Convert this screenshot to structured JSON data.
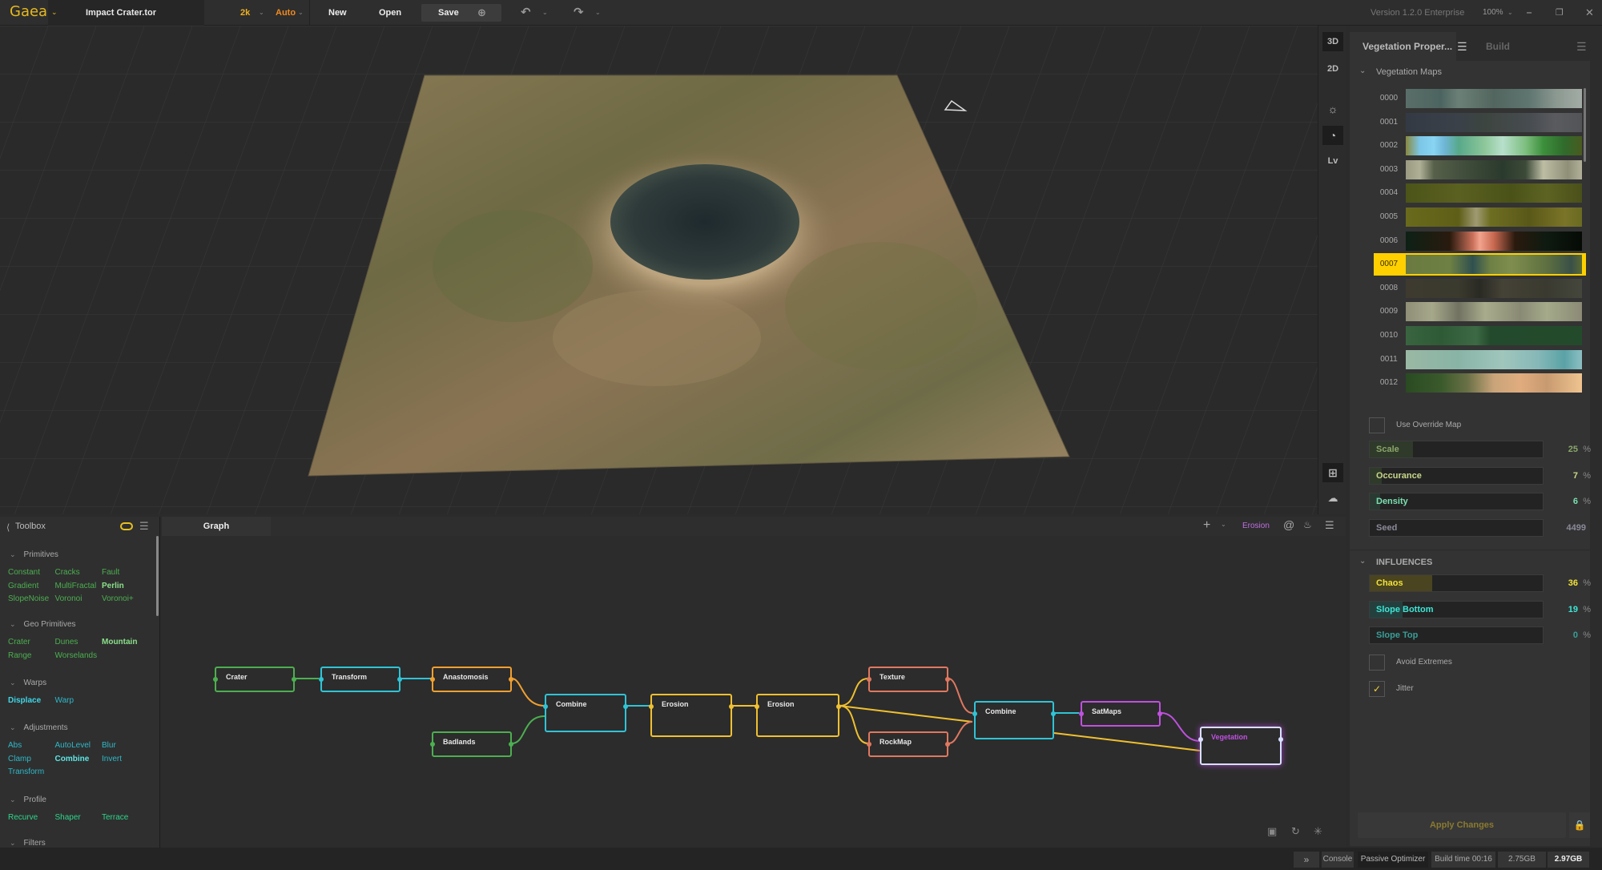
{
  "app": {
    "name": "Gaea",
    "file_name": "Impact Crater.tor",
    "resolution": "2k",
    "build_mode": "Auto",
    "new_label": "New",
    "open_label": "Open",
    "save_label": "Save",
    "version": "Version 1.2.0 Enterprise",
    "zoom": "100%"
  },
  "viewport": {
    "buttons": [
      "3D",
      "2D",
      "Lv"
    ],
    "active_mode": "3D"
  },
  "right_panel": {
    "tabs": [
      "Vegetation Proper...",
      "Build"
    ],
    "section_maps": "Vegetation Maps",
    "maps": [
      {
        "id": "0000",
        "gradient": "linear-gradient(90deg,#5a6e68,#4c6460 20%,#6b8076 30%,#52665f 50%,#5f7570 70%,#8a9890 85%,#a3aca6)"
      },
      {
        "id": "0001",
        "gradient": "linear-gradient(90deg,#343a44,#3a4149 30%,#3d4540 45%,#474c50 70%,#5a5b5f 85%,#525457)"
      },
      {
        "id": "0002",
        "gradient": "linear-gradient(90deg,#8a8a3e,#7cc6e8 8%,#88d4f2 16%,#6fb5d6 22%,#57a98a 30%,#8ec79a 45%,#b8e0cc 55%,#7ebe7f 68%,#3d8f3c 78%,#2f6b2b 90%,#4a5a20)"
      },
      {
        "id": "0003",
        "gradient": "linear-gradient(90deg,#9a9a82,#b0b096 8%,#56604a 16%,#3f4c3a 35%,#2a3a2c 55%,#3c4a38 68%,#bdbda4 78%,#8f8f78 92%,#b2b098)"
      },
      {
        "id": "0004",
        "gradient": "linear-gradient(90deg,#4c5418,#5a6020 30%,#4a5218 60%,#5d6322 80%,#4a5019)"
      },
      {
        "id": "0005",
        "gradient": "linear-gradient(90deg,#6a6a1c,#5e5e18 30%,#a09a72 40%,#6e6e22 48%,#5a5818 70%,#7a7428 90%,#6a6a22)"
      },
      {
        "id": "0006",
        "gradient": "linear-gradient(90deg,#0d2015,#2a1a0e 25%,#c9705a 38%,#f2a38e 42%,#c86850 50%,#2a1a0e 62%,#0e1a10 80%,#050a05)"
      },
      {
        "id": "0007",
        "gradient": "linear-gradient(90deg,#6a7a40,#6e8044 25%,#2f5050 38%,#6e8044 48%,#7f8e4e 60%,#5e7040 80%,#3a5048 94%,#5a6a32)"
      },
      {
        "id": "0008",
        "gradient": "linear-gradient(90deg,#3e3a30,#3a3a2e 30%,#2a2a24 42%,#454236 55%,#3a3a30 80%,#45473c)"
      },
      {
        "id": "0009",
        "gradient": "linear-gradient(90deg,#8f8e78,#a6a88a 15%,#727262 30%,#a8ac8c 45%,#8a8a74 65%,#a4aa8a 80%,#8c8a76)"
      },
      {
        "id": "0010",
        "gradient": "linear-gradient(90deg,#3a6440,#2e5a36 20%,#3d6a44 40%,#234a2c 48%,#244a2c 100%)"
      },
      {
        "id": "0011",
        "gradient": "linear-gradient(90deg,#9ab8a4,#88b4a6 30%,#a0c6bc 55%,#86b8b8 75%,#5aa2a6 90%,#8cc0c4)"
      },
      {
        "id": "0012",
        "gradient": "linear-gradient(90deg,#2a4a22,#3a5a2c 20%,#6a7046 35%,#c9a47a 50%,#e0ac7e 65%,#c89a70 80%,#f0c490)"
      }
    ],
    "selected_map": "0007",
    "use_override_label": "Use Override Map",
    "use_override_checked": false,
    "params": [
      {
        "name": "Scale",
        "value": "25",
        "unit": "%",
        "fraction": 0.25,
        "color": "#8aa66a",
        "fill": "#2f3a2a",
        "dim": true
      },
      {
        "name": "Occurance",
        "value": "7",
        "unit": "%",
        "fraction": 0.07,
        "color": "#c8d88a",
        "fill": "#2f3a2a",
        "dim": false
      },
      {
        "name": "Density",
        "value": "6",
        "unit": "%",
        "fraction": 0.06,
        "color": "#7be0b0",
        "fill": "#2a3a32",
        "dim": false
      },
      {
        "name": "Seed",
        "value": "4499",
        "unit": "",
        "fraction": 0.0,
        "color": "#8a8a9a",
        "fill": "#2a2a2a",
        "dim": true
      }
    ],
    "section_influences": "INFLUENCES",
    "influences": [
      {
        "name": "Chaos",
        "value": "36",
        "unit": "%",
        "fraction": 0.36,
        "color": "#f2e23a",
        "fill": "#4a4420"
      },
      {
        "name": "Slope Bottom",
        "value": "19",
        "unit": "%",
        "fraction": 0.19,
        "color": "#3ce6d6",
        "fill": "#24403e"
      },
      {
        "name": "Slope Top",
        "value": "0",
        "unit": "%",
        "fraction": 0.0,
        "color": "#3a9e98",
        "fill": "#2a2a2a"
      }
    ],
    "checks": [
      {
        "label": "Avoid Extremes",
        "checked": false
      },
      {
        "label": "Jitter",
        "checked": true
      }
    ],
    "apply_label": "Apply Changes"
  },
  "toolbox": {
    "title": "Toolbox",
    "sections": [
      {
        "name": "Primitives",
        "nodes": [
          {
            "label": "Constant",
            "color": "#4caf50",
            "bold": false
          },
          {
            "label": "Cracks",
            "color": "#4caf50",
            "bold": false
          },
          {
            "label": "Fault",
            "color": "#4caf50",
            "bold": false
          },
          {
            "label": "Gradient",
            "color": "#4caf50",
            "bold": false
          },
          {
            "label": "MultiFractal",
            "color": "#4caf50",
            "bold": false
          },
          {
            "label": "Perlin",
            "color": "#8be08b",
            "bold": true
          },
          {
            "label": "SlopeNoise",
            "color": "#4caf50",
            "bold": false
          },
          {
            "label": "Voronoi",
            "color": "#4caf50",
            "bold": false
          },
          {
            "label": "Voronoi+",
            "color": "#4caf50",
            "bold": false
          }
        ]
      },
      {
        "name": "Geo Primitives",
        "nodes": [
          {
            "label": "Crater",
            "color": "#4caf50",
            "bold": false
          },
          {
            "label": "Dunes",
            "color": "#4caf50",
            "bold": false
          },
          {
            "label": "Mountain",
            "color": "#8be08b",
            "bold": true
          },
          {
            "label": "Range",
            "color": "#4caf50",
            "bold": false
          },
          {
            "label": "Worselands",
            "color": "#4caf50",
            "bold": false
          }
        ]
      },
      {
        "name": "Warps",
        "nodes": [
          {
            "label": "Displace",
            "color": "#3ed6e6",
            "bold": true
          },
          {
            "label": "Warp",
            "color": "#2fb8c8",
            "bold": false
          }
        ]
      },
      {
        "name": "Adjustments",
        "nodes": [
          {
            "label": "Abs",
            "color": "#2fb8c8",
            "bold": false
          },
          {
            "label": "AutoLevel",
            "color": "#2fb8c8",
            "bold": false
          },
          {
            "label": "Blur",
            "color": "#2fb8c8",
            "bold": false
          },
          {
            "label": "Clamp",
            "color": "#2fb8c8",
            "bold": false
          },
          {
            "label": "Combine",
            "color": "#5ee6e6",
            "bold": true
          },
          {
            "label": "Invert",
            "color": "#2fb8c8",
            "bold": false
          },
          {
            "label": "Transform",
            "color": "#2fb8c8",
            "bold": false
          }
        ]
      },
      {
        "name": "Profile",
        "nodes": [
          {
            "label": "Recurve",
            "color": "#2ed68a",
            "bold": false
          },
          {
            "label": "Shaper",
            "color": "#2ed68a",
            "bold": false
          },
          {
            "label": "Terrace",
            "color": "#2ed68a",
            "bold": false
          }
        ]
      },
      {
        "name": "Filters",
        "nodes": []
      }
    ]
  },
  "graph": {
    "tab": "Graph",
    "active_node": "Erosion",
    "nodes": [
      {
        "id": "crater",
        "label": "Crater",
        "color": "#4caf50"
      },
      {
        "id": "transform",
        "label": "Transform",
        "color": "#2fc4d6"
      },
      {
        "id": "anastomosis",
        "label": "Anastomosis",
        "color": "#f0a030"
      },
      {
        "id": "badlands",
        "label": "Badlands",
        "color": "#4caf50"
      },
      {
        "id": "combine1",
        "label": "Combine",
        "color": "#2fc4d6"
      },
      {
        "id": "erosion1",
        "label": "Erosion",
        "color": "#f0c030"
      },
      {
        "id": "erosion2",
        "label": "Erosion",
        "color": "#f0c030"
      },
      {
        "id": "texture",
        "label": "Texture",
        "color": "#e07860"
      },
      {
        "id": "rockmap",
        "label": "RockMap",
        "color": "#e07860"
      },
      {
        "id": "combine2",
        "label": "Combine",
        "color": "#2fc4d6"
      },
      {
        "id": "satmaps",
        "label": "SatMaps",
        "color": "#c050e0"
      },
      {
        "id": "vegetation",
        "label": "Vegetation",
        "color": "#d8e0ff"
      }
    ]
  },
  "status": {
    "console": "Console",
    "optimizer": "Passive Optimizer",
    "build_time": "Build time 00:16",
    "mem1": "2.75GB",
    "mem2": "2.97GB"
  }
}
